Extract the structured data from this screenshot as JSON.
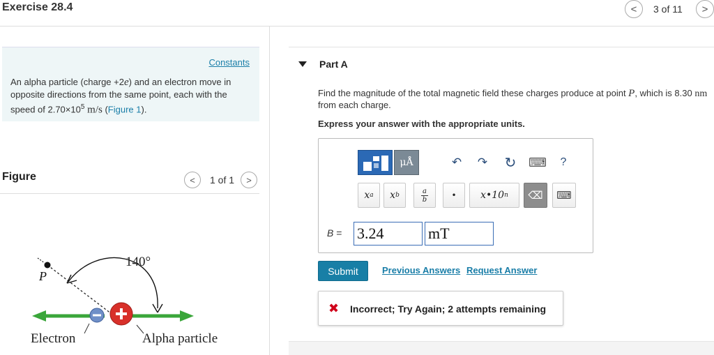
{
  "header": {
    "title": "Exercise 28.4",
    "pager_text": "3 of 11",
    "prev_icon": "<",
    "next_icon": ">"
  },
  "intro": {
    "constants_link": "Constants",
    "problem_p1": "An alpha particle (charge +2",
    "problem_e": "e",
    "problem_p2": ") and an electron move in opposite directions from the same point, each with the speed of 2.70×10",
    "problem_exp": "5",
    "problem_units": " m/s",
    "problem_p3": " (",
    "figure_link": "Figure 1",
    "problem_p4": ")."
  },
  "figure": {
    "label": "Figure",
    "pager_text": "1 of 1",
    "prev_icon": "<",
    "next_icon": ">",
    "angle_label": "140°",
    "point_label": "P",
    "electron_label": "Electron",
    "alpha_label": "Alpha particle"
  },
  "part": {
    "title": "Part A",
    "question_p1": "Find the magnitude of the total magnetic field these charges produce at point ",
    "question_point": "P",
    "question_p2": ", which is 8.30 ",
    "question_unit": "nm",
    "question_p3": " from each charge.",
    "instruction": "Express your answer with the appropriate units."
  },
  "toolbar": {
    "units_label": "μÅ",
    "undo_icon": "↶",
    "redo_icon": "↷",
    "reset_icon": "↻",
    "keyboard_icon": "⌨",
    "help_label": "?",
    "superscript_base": "x",
    "superscript_exp": "a",
    "subscript_base": "x",
    "subscript_sub": "b",
    "fraction_num": "a",
    "fraction_den": "b",
    "dot_label": "•",
    "sci_label": "x•10",
    "sci_exp": "n",
    "backspace_icon": "⌫"
  },
  "answer": {
    "variable": "B",
    "equals": " =",
    "value": "3.24",
    "unit": "mT"
  },
  "actions": {
    "submit": "Submit",
    "previous_answers": "Previous Answers",
    "request_answer": "Request Answer"
  },
  "feedback": {
    "icon": "✖",
    "message": "Incorrect; Try Again; 2 attempts remaining"
  },
  "colors": {
    "accent": "#187fa6",
    "link": "#1a7ea8",
    "error": "#d0021b",
    "intro_bg": "#eef6f7",
    "arrow_green": "#3aa63a",
    "alpha_red": "#d8302a",
    "electron_blue": "#6f8fc8"
  }
}
